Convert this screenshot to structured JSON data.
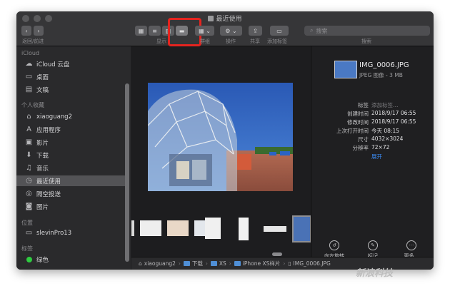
{
  "window": {
    "title": "最近使用"
  },
  "toolbar": {
    "nav_label": "返回/前进",
    "view_label": "显示",
    "group_label": "群组",
    "action_label": "操作",
    "share_label": "共享",
    "tag_label": "添加标签",
    "search_label": "搜索",
    "search_placeholder": "搜索"
  },
  "sidebar": {
    "sections": [
      {
        "title": "iCloud",
        "items": [
          {
            "label": "iCloud 云盘",
            "icon": "cloud-icon"
          },
          {
            "label": "桌面",
            "icon": "desktop-icon"
          },
          {
            "label": "文稿",
            "icon": "document-icon"
          }
        ]
      },
      {
        "title": "个人收藏",
        "items": [
          {
            "label": "xiaoguang2",
            "icon": "home-icon"
          },
          {
            "label": "应用程序",
            "icon": "applications-icon"
          },
          {
            "label": "影片",
            "icon": "movies-icon"
          },
          {
            "label": "下载",
            "icon": "download-icon"
          },
          {
            "label": "音乐",
            "icon": "music-icon"
          },
          {
            "label": "最近使用",
            "icon": "clock-icon"
          },
          {
            "label": "隔空投送",
            "icon": "airdrop-icon"
          },
          {
            "label": "图片",
            "icon": "camera-icon"
          }
        ]
      },
      {
        "title": "位置",
        "items": [
          {
            "label": "slevinPro13",
            "icon": "laptop-icon"
          }
        ]
      },
      {
        "title": "标签",
        "items": [
          {
            "label": "绿色",
            "icon": "green-tag-icon"
          }
        ]
      }
    ]
  },
  "info": {
    "filename": "IMG_0006.JPG",
    "kind": "JPEG 图像 - 3 MB",
    "rows": [
      {
        "key": "标签",
        "value": "添加标签…"
      },
      {
        "key": "创建时间",
        "value": "2018/9/17 06:55"
      },
      {
        "key": "修改时间",
        "value": "2018/9/17 06:55"
      },
      {
        "key": "上次打开时间",
        "value": "今天 08:15"
      },
      {
        "key": "尺寸",
        "value": "4032×3024"
      },
      {
        "key": "分辨率",
        "value": "72×72"
      }
    ],
    "expand": "展开",
    "actions": [
      {
        "label": "向左旋转"
      },
      {
        "label": "标记"
      },
      {
        "label": "更多…"
      }
    ]
  },
  "pathbar": [
    "xiaoguang2",
    "下载",
    "XS",
    "iPhone XS样片",
    "IMG_0006.JPG"
  ],
  "watermark": "新浪科技",
  "colors": {
    "highlight_box": "#e5241f",
    "accent": "#3b8cf5",
    "tag_green": "#2ecc40"
  }
}
